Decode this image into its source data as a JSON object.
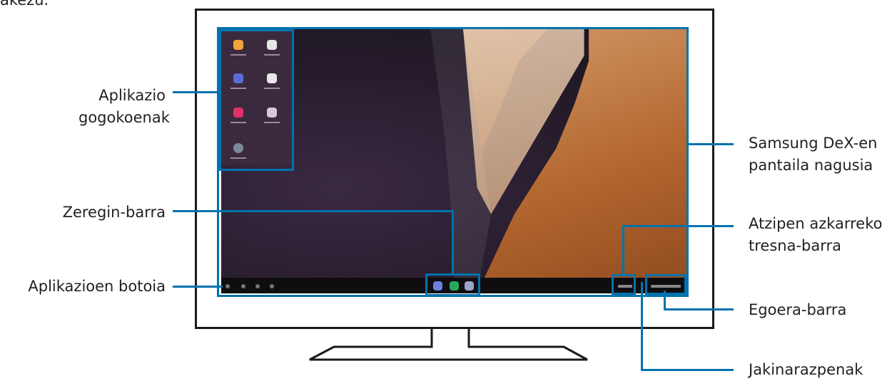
{
  "top_fragment": "akezu.",
  "labels": {
    "favorite_apps": [
      "Aplikazio",
      "gogokoenak"
    ],
    "main_screen": [
      "Samsung DeX-en",
      "pantaila nagusia"
    ],
    "taskbar": "Zeregin-barra",
    "quick_access_toolbar": [
      "Atzipen azkarreko",
      "tresna-barra"
    ],
    "apps_button": "Aplikazioen botoia",
    "status_bar": "Egoera-barra",
    "notifications": "Jakinarazpenak"
  },
  "colors": {
    "callout": "#0073ae",
    "monitor_frame": "#1a1a1a"
  },
  "icons": [
    "email-app-icon",
    "google-app-icon",
    "gallery-app-icon",
    "play-store-icon",
    "flower-app-icon",
    "game-app-icon",
    "settings-app-icon"
  ]
}
